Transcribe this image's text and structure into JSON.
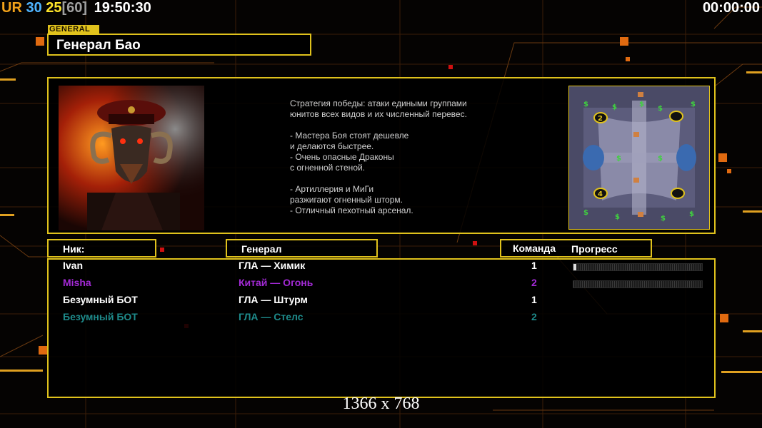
{
  "hud": {
    "ur_label": "UR",
    "fps_a": "30",
    "fps_b": "25",
    "fps_max": "[60]",
    "clock": "19:50:30",
    "timer": "00:00:00"
  },
  "general": {
    "tag": "GENERAL",
    "name": "Генерал Бао",
    "portrait_icon": "general-bao-portrait",
    "description_lines": [
      "Стратегия победы: атаки едиными группами",
      "юнитов всех видов и их численный перевес.",
      "",
      "- Мастера Боя стоят дешевле",
      "и делаются быстрее.",
      "- Очень опасные Драконы",
      "с огненной стеной.",
      "",
      "- Артиллерия и МиГи",
      "разжигают огненный шторм.",
      "- Отличный пехотный арсенал."
    ]
  },
  "minimap": {
    "icon": "map-preview",
    "start_markers": [
      "2",
      "4"
    ]
  },
  "table": {
    "headers": {
      "nick": "Ник:",
      "general": "Генерал",
      "team": "Команда",
      "progress": "Прогресс"
    },
    "rows": [
      {
        "nick": "Ivan",
        "general": "ГЛА — Химик",
        "team": "1",
        "color": "#ffffff",
        "progress": 0.02
      },
      {
        "nick": "Misha",
        "general": "Китай — Огонь",
        "team": "2",
        "color": "#a32ad6",
        "progress": 0.0
      },
      {
        "nick": "Безумный БОТ",
        "general": "ГЛА — Штурм",
        "team": "1",
        "color": "#ffffff"
      },
      {
        "nick": "Безумный БОТ",
        "general": "ГЛА — Стелс",
        "team": "2",
        "color": "#1e8b8b"
      }
    ]
  },
  "resolution": "1366 x 768",
  "colors": {
    "accent": "#e0c21c",
    "ur": "#f2a21a",
    "fps_a": "#4fb4ff",
    "fps_b": "#ffe52a",
    "fps_max": "#a0a0a0"
  }
}
